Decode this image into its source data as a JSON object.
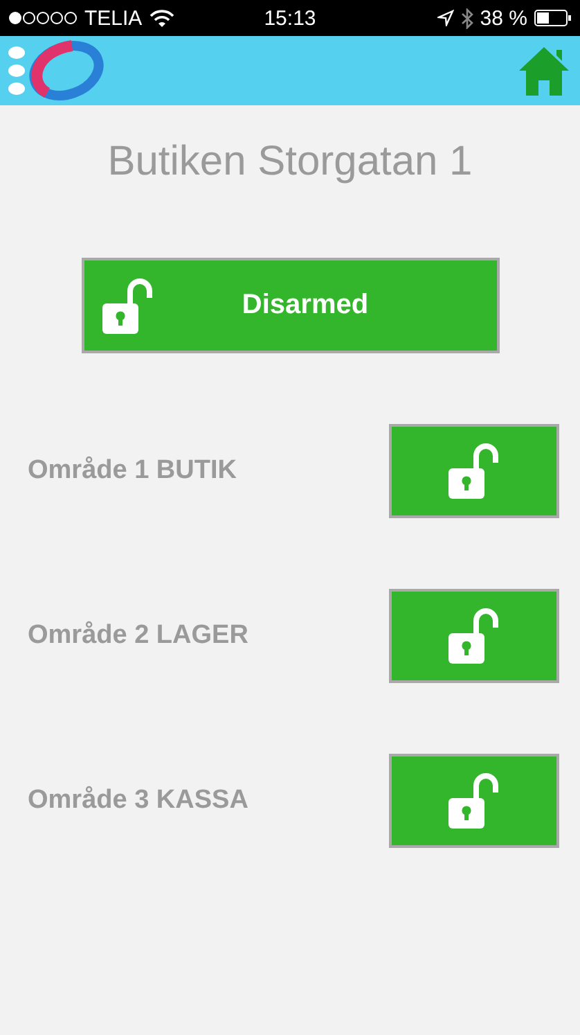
{
  "status_bar": {
    "carrier": "TELIA",
    "time": "15:13",
    "battery": "38 %"
  },
  "title": "Butiken Storgatan 1",
  "main_button": {
    "label": "Disarmed",
    "armed": false
  },
  "areas": [
    {
      "label": "Område 1 BUTIK",
      "armed": false
    },
    {
      "label": "Område 2 LAGER",
      "armed": false
    },
    {
      "label": "Område 3 KASSA",
      "armed": false
    }
  ]
}
